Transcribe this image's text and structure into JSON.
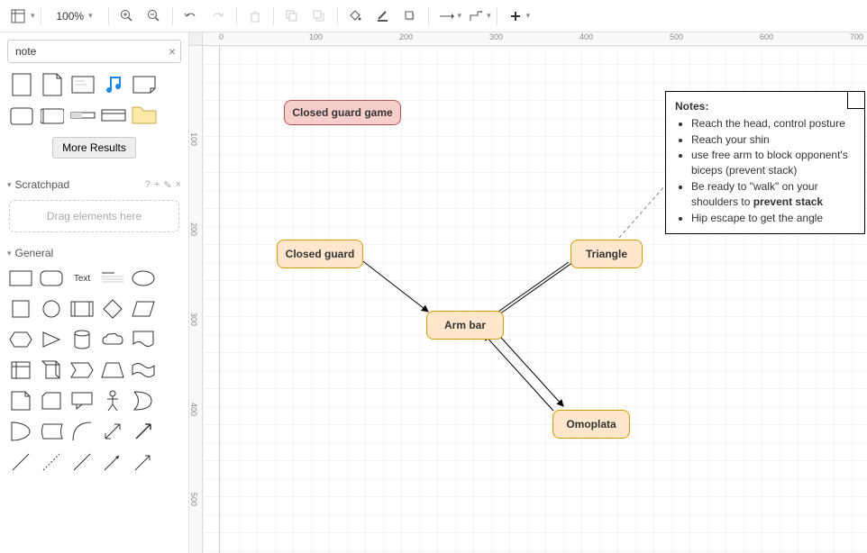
{
  "toolbar": {
    "zoom": "100%",
    "icons": [
      "layout",
      "zoom-in",
      "zoom-out",
      "undo",
      "redo",
      "delete",
      "to-front",
      "to-back",
      "fill",
      "stroke",
      "shadow",
      "connection",
      "waypoint",
      "add"
    ]
  },
  "search": {
    "value": "note"
  },
  "search_shapes": [
    "page",
    "page-fold",
    "card",
    "music-note",
    "sticky",
    "scroll-2",
    "scroll",
    "progress",
    "terminal",
    "folder-note"
  ],
  "more_results": "More Results",
  "scratchpad": {
    "title": "Scratchpad",
    "tools": [
      "?",
      "+",
      "✎",
      "×"
    ],
    "drop": "Drag elements here"
  },
  "general": {
    "title": "General"
  },
  "ruler_h": [
    "0",
    "100",
    "200",
    "300",
    "400",
    "500",
    "600",
    "700"
  ],
  "ruler_v": [
    "100",
    "200",
    "300",
    "400",
    "500"
  ],
  "diagram": {
    "title": "Closed guard game",
    "nodes": {
      "closed_guard": "Closed guard",
      "armbar": "Arm bar",
      "triangle": "Triangle",
      "omoplata": "Omoplata"
    },
    "notes": {
      "title": "Notes:",
      "items_html": [
        "Reach the head, control posture",
        "Reach your shin",
        "use free arm to block opponent's biceps (prevent stack)",
        "Be ready to \"walk\" on your shoulders to <strong>prevent stack</strong>",
        "Hip escape to get the angle"
      ]
    }
  }
}
